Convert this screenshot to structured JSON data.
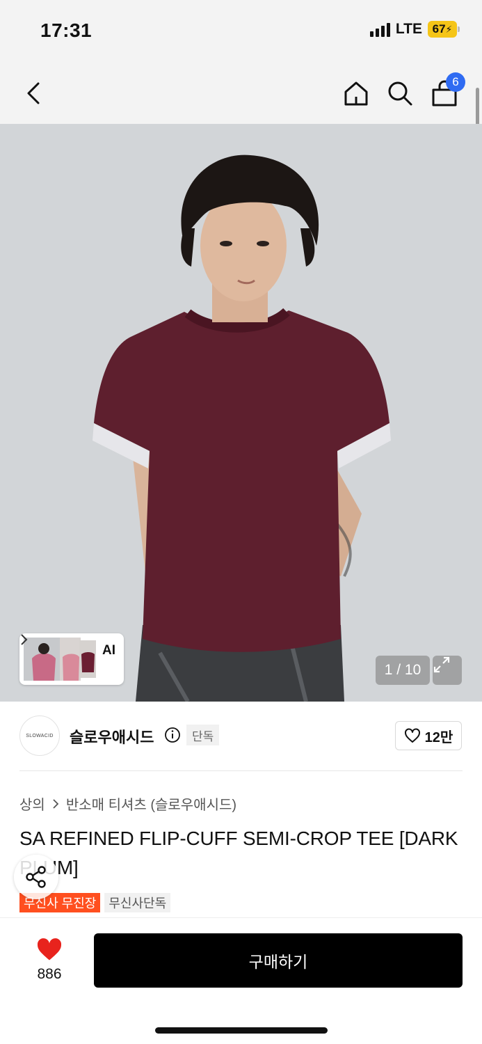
{
  "status_bar": {
    "time": "17:31",
    "network": "LTE",
    "battery": "67"
  },
  "nav": {
    "back_icon": "chevron-left-icon",
    "home_icon": "home-icon",
    "search_icon": "search-icon",
    "cart_icon": "shopping-bag-icon",
    "cart_count": "6"
  },
  "gallery": {
    "counter": "1 / 10",
    "ai_label": "AI",
    "expand_icon": "expand-icon"
  },
  "brand": {
    "name": "슬로우애시드",
    "logo_text": "SLOWACID",
    "exclusive": "단독",
    "likes": "12만"
  },
  "breadcrumb": {
    "category": "상의",
    "subcategory": "반소매 티셔츠 (슬로우애시드)"
  },
  "product": {
    "title": "SA REFINED FLIP-CUFF SEMI-CROP TEE [DARK PLUM]"
  },
  "tags": [
    "무신사 무진장",
    "무신사단독"
  ],
  "bottom": {
    "wish_count": "886",
    "buy_label": "구매하기"
  },
  "colors": {
    "accent_red": "#ff4f1f",
    "badge_blue": "#2f6bf2",
    "heart_red": "#e8231d",
    "shirt": "#5e1f2e"
  }
}
